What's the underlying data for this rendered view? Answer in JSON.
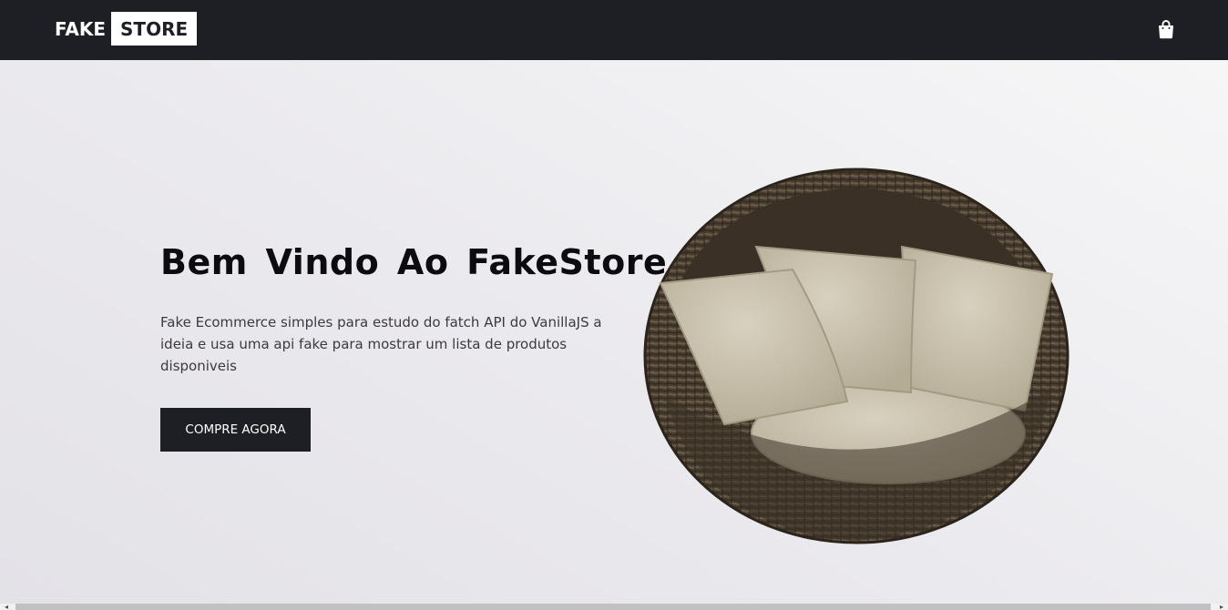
{
  "header": {
    "logo_fake": "FAKE",
    "logo_store": "STORE",
    "cart_icon": "shopping-bag-icon"
  },
  "hero": {
    "title": "Bem Vindo Ao FakeStore",
    "description": "Fake Ecommerce simples para estudo do fatch API do VanillaJS a ideia e usa uma api fake para mostrar um lista de produtos disponiveis",
    "cta_label": "COMPRE AGORA",
    "image": "wicker-chair-with-cushions"
  },
  "colors": {
    "header_bg": "#1e1f24",
    "button_bg": "#1e1f24",
    "hero_bg": "#ebeaee"
  }
}
